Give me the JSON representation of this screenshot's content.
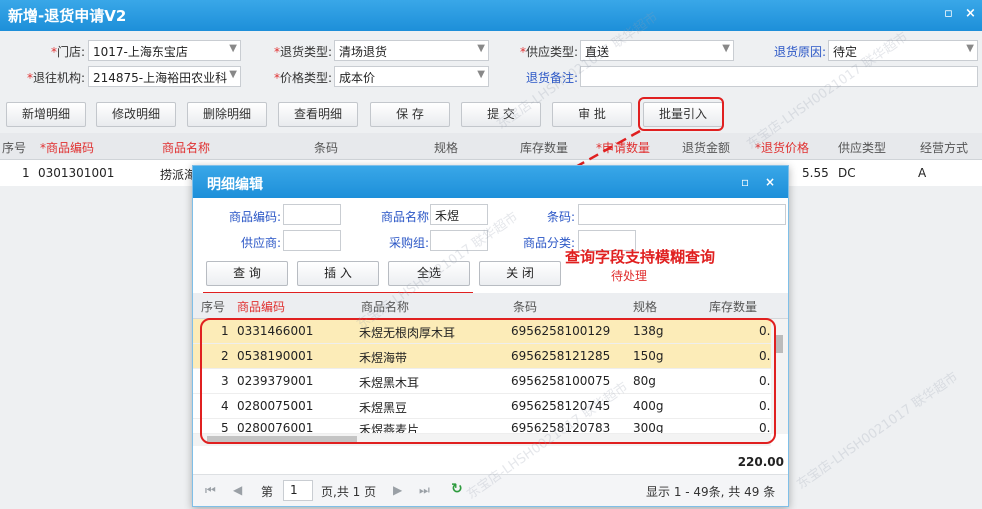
{
  "window": {
    "title": "新增-退货申请V2",
    "max_icon": "▫",
    "close_icon": "×"
  },
  "form": {
    "store_label": "门店:",
    "store_value": "1017-上海东宝店",
    "return_type_label": "退货类型:",
    "return_type_value": "清场退货",
    "supply_type_label": "供应类型:",
    "supply_type_value": "直送",
    "reason_label": "退货原因:",
    "reason_value": "待定",
    "org_label": "退往机构:",
    "org_value": "214875-上海裕田农业科",
    "price_type_label": "价格类型:",
    "price_type_value": "成本价",
    "remark_label": "退货备注:",
    "remark_value": ""
  },
  "toolbar": {
    "add": "新增明细",
    "edit": "修改明细",
    "delete": "删除明细",
    "view": "查看明细",
    "save": "保 存",
    "submit": "提 交",
    "approve": "审 批",
    "batch": "批量引入"
  },
  "grid": {
    "headers": [
      "序号",
      "商品编码",
      "商品名称",
      "条码",
      "规格",
      "库存数量",
      "申请数量",
      "退货金额",
      "退货价格",
      "供应类型",
      "经营方式"
    ],
    "row": {
      "no": "1",
      "code": "0301301001",
      "name": "捞派海",
      "price": "5.55",
      "supply": "DC",
      "mode": "A"
    }
  },
  "dialog": {
    "title": "明细编辑",
    "code_label": "商品编码:",
    "code_value": "",
    "name_label": "商品名称",
    "name_value": "禾煜",
    "barcode_label": "条码:",
    "barcode_value": "",
    "supplier_label": "供应商:",
    "supplier_value": "",
    "purchase_label": "采购组:",
    "purchase_value": "",
    "category_label": "商品分类:",
    "category_value": "",
    "btn_query": "查 询",
    "btn_insert": "插 入",
    "btn_all": "全选",
    "btn_close": "关 闭",
    "status": "待处理",
    "annotation": "查询字段支持模糊查询",
    "headers": [
      "序号",
      "商品编码",
      "商品名称",
      "条码",
      "规格",
      "库存数量"
    ],
    "rows": [
      {
        "no": "1",
        "code": "0331466001",
        "name": "禾煜无根肉厚木耳",
        "barcode": "6956258100129",
        "spec": "138g",
        "stock": "0."
      },
      {
        "no": "2",
        "code": "0538190001",
        "name": "禾煜海带",
        "barcode": "6956258121285",
        "spec": "150g",
        "stock": "0."
      },
      {
        "no": "3",
        "code": "0239379001",
        "name": "禾煜黑木耳",
        "barcode": "6956258100075",
        "spec": "80g",
        "stock": "0."
      },
      {
        "no": "4",
        "code": "0280075001",
        "name": "禾煜黑豆",
        "barcode": "6956258120745",
        "spec": "400g",
        "stock": "0."
      },
      {
        "no": "5",
        "code": "0280076001",
        "name": "禾煜燕麦片",
        "barcode": "6956258120783",
        "spec": "300g",
        "stock": "0."
      }
    ],
    "total": "220.00",
    "pager": {
      "page_prefix": "第",
      "page_value": "1",
      "page_suffix": "页,共 1 页",
      "summary": "显示 1 - 49条, 共 49 条"
    }
  },
  "watermark": "东宝店-LHSH0021017 联华超市"
}
